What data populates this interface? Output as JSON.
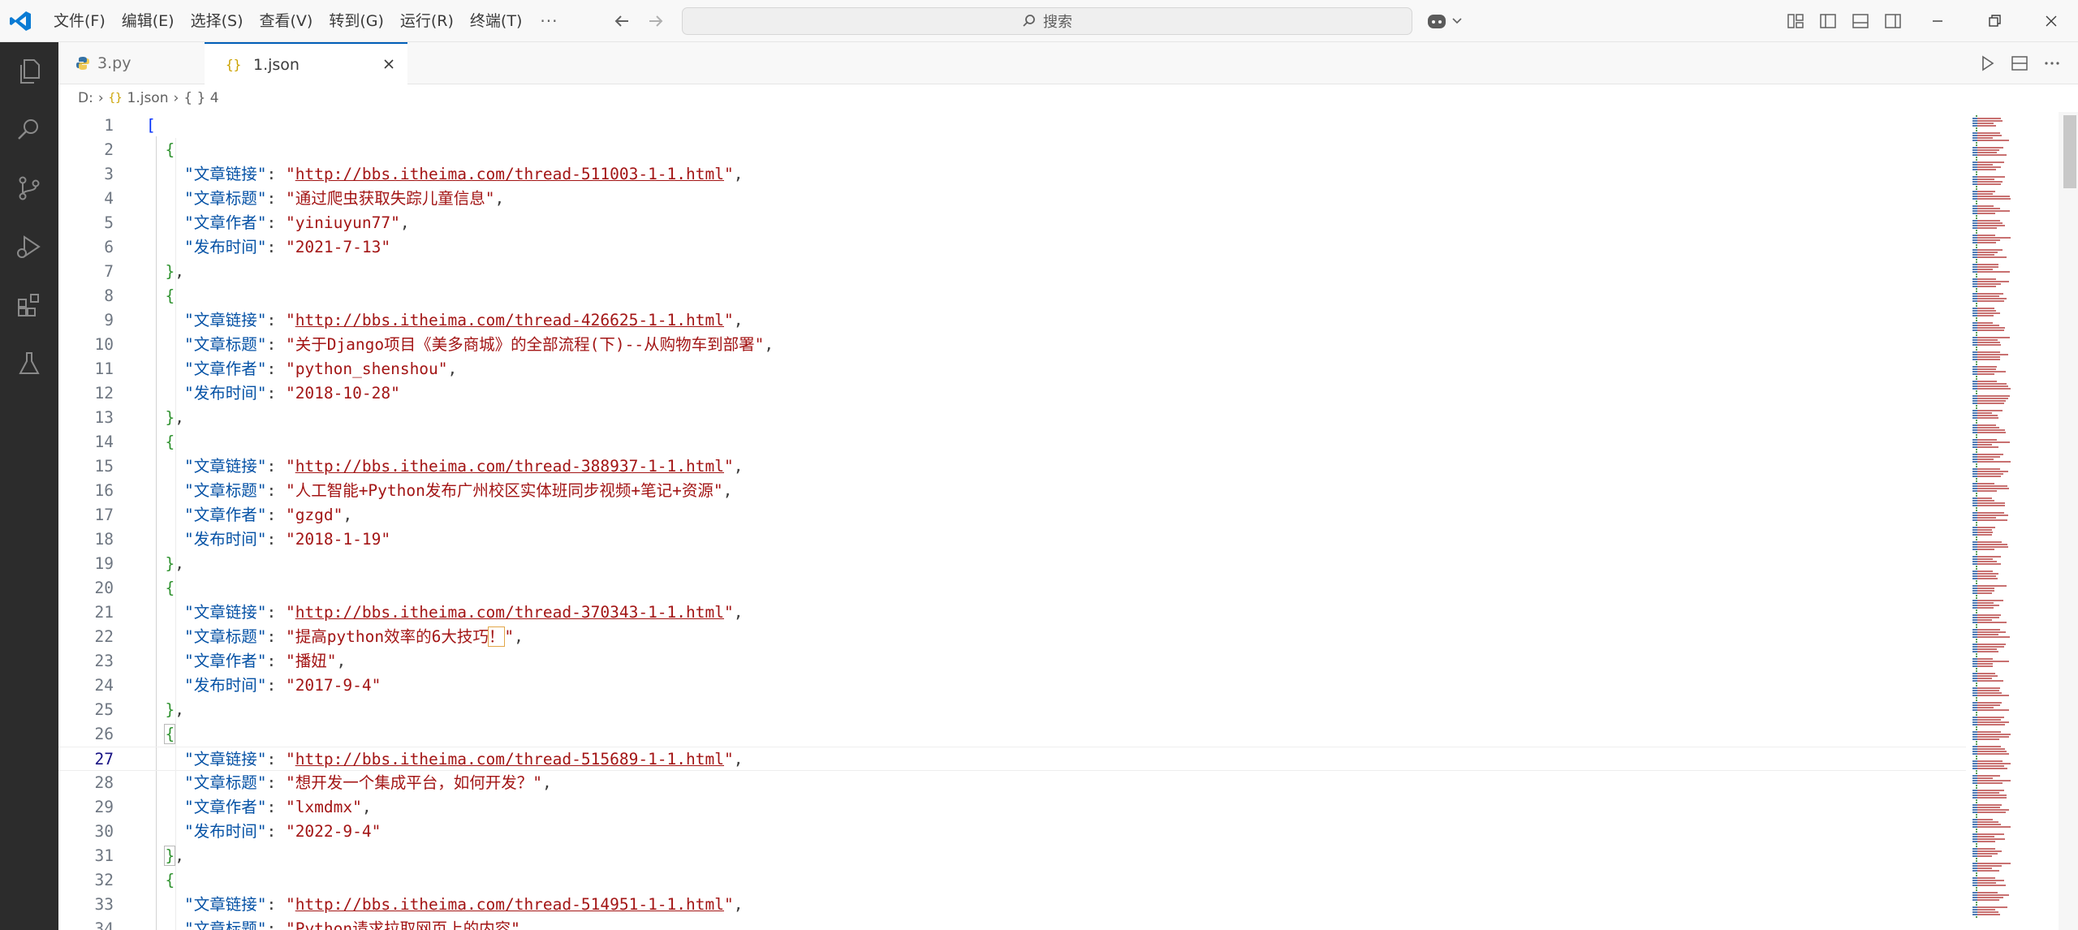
{
  "titlebar": {
    "menu": [
      "文件(F)",
      "编辑(E)",
      "选择(S)",
      "查看(V)",
      "转到(G)",
      "运行(R)",
      "终端(T)"
    ],
    "more": "···",
    "search_placeholder": "搜索"
  },
  "activity": [
    "explorer-icon",
    "search-icon",
    "source-control-icon",
    "run-debug-icon",
    "extensions-icon",
    "testing-icon"
  ],
  "tabs": [
    {
      "label": "3.py",
      "icon": "python-file-icon",
      "active": false
    },
    {
      "label": "1.json",
      "icon": "json-file-icon",
      "active": true
    }
  ],
  "breadcrumb": {
    "drive": "D:",
    "file": "1.json",
    "node": "{ } 4"
  },
  "editor": {
    "current_line": 27,
    "records": [
      {
        "url": "http://bbs.itheima.com/thread-511003-1-1.html",
        "title": "通过爬虫获取失踪儿童信息",
        "author": "yiniuyun77",
        "date": "2021-7-13"
      },
      {
        "url": "http://bbs.itheima.com/thread-426625-1-1.html",
        "title": "关于Django项目《美多商城》的全部流程(下)--从购物车到部署",
        "author": "python_shenshou",
        "date": "2018-10-28"
      },
      {
        "url": "http://bbs.itheima.com/thread-388937-1-1.html",
        "title": "人工智能+Python发布广州校区实体班同步视频+笔记+资源",
        "author": "gzgd",
        "date": "2018-1-19"
      },
      {
        "url": "http://bbs.itheima.com/thread-370343-1-1.html",
        "title": "提高python效率的6大技巧！",
        "author": "播妞",
        "date": "2017-9-4"
      },
      {
        "url": "http://bbs.itheima.com/thread-515689-1-1.html",
        "title": "想开发一个集成平台，如何开发？",
        "author": "lxmdmx",
        "date": "2022-9-4"
      },
      {
        "url": "http://bbs.itheima.com/thread-514951-1-1.html",
        "title": "Python请求拉取网页上的内容",
        "author": "",
        "date": ""
      }
    ],
    "keys": {
      "url": "文章链接",
      "title": "文章标题",
      "author": "文章作者",
      "date": "发布时间"
    }
  },
  "colors": {
    "accent": "#005fb8",
    "activity_bg": "#2c2c2c",
    "string": "#a31515",
    "key": "#0451a5"
  }
}
